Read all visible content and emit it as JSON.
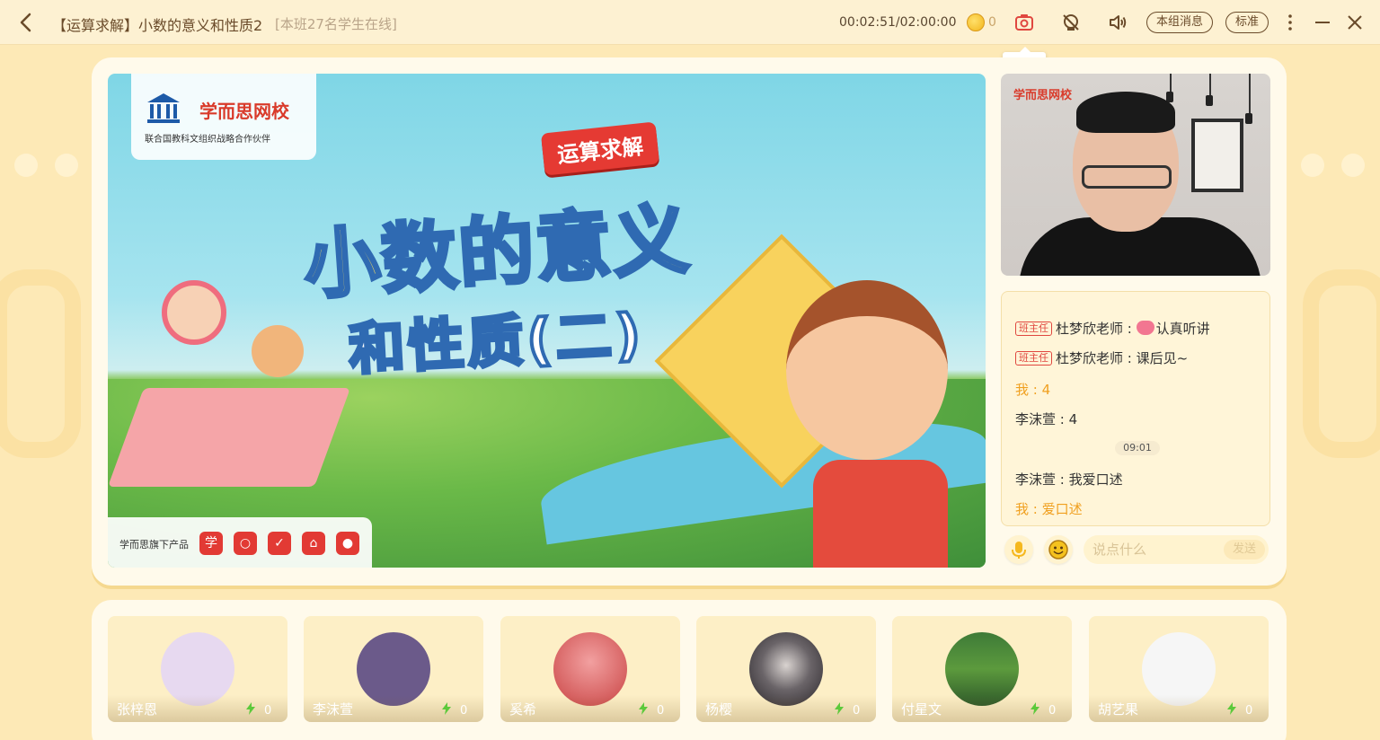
{
  "header": {
    "title": "【运算求解】小数的意义和性质2",
    "online": "[本班27名学生在线]",
    "timer": "00:02:51/02:00:00",
    "coins": "0",
    "group_msg_label": "本组消息",
    "quality_label": "标准",
    "screenshot_tooltip": "截屏"
  },
  "slide": {
    "logo_name": "学而思网校",
    "logo_sub": "联合国教科文组织战略合作伙伴",
    "badge": "运算求解",
    "title": "小数的意义",
    "subtitle": "和性质(二)",
    "products_label": "学而思旗下产品",
    "product_icons": [
      "学",
      "○",
      "✓",
      "⌂",
      "●"
    ]
  },
  "teacher": {
    "logo": "学而思网校"
  },
  "chat": {
    "messages": [
      {
        "role": "班主任",
        "sender": "杜梦欣老师",
        "text": "认真听讲",
        "emoji": "heart"
      },
      {
        "role": "班主任",
        "sender": "杜梦欣老师",
        "text": "课后见~"
      },
      {
        "sender": "我",
        "text": "4",
        "me": true
      },
      {
        "sender": "李沫萱",
        "text": "4"
      },
      {
        "sender": "李沫萱",
        "text": "我爱口述"
      },
      {
        "sender": "我",
        "text": "爱口述",
        "me": true
      }
    ],
    "time_chip": "09:01",
    "m1": "杜梦欣老师 : ",
    "m1_text": "认真听讲",
    "m2": "杜梦欣老师 : 课后见~",
    "m3": "我 : 4",
    "m4": "李沫萱 : 4",
    "m5": "李沫萱 : 我爱口述",
    "m6": "我 : 爱口述",
    "role": "班主任",
    "input_placeholder": "说点什么",
    "send_label": "发送"
  },
  "students": [
    {
      "name": "张梓恩",
      "score": "0",
      "avatar_color": "#e7d9f0"
    },
    {
      "name": "李沫萱",
      "score": "0",
      "avatar_color": "#6b5a8a"
    },
    {
      "name": "奚希",
      "score": "0",
      "avatar_color": "#e06a6a"
    },
    {
      "name": "杨樱",
      "score": "0",
      "avatar_color": "#3a3a44"
    },
    {
      "name": "付星文",
      "score": "0",
      "avatar_color": "#3f7a3a"
    },
    {
      "name": "胡艺果",
      "score": "0",
      "avatar_color": "#f4f4f4"
    }
  ],
  "colors": {
    "accent": "#f0a020",
    "background": "#fde9b6",
    "panel": "#fffaeb",
    "brand_red": "#e53a33"
  }
}
